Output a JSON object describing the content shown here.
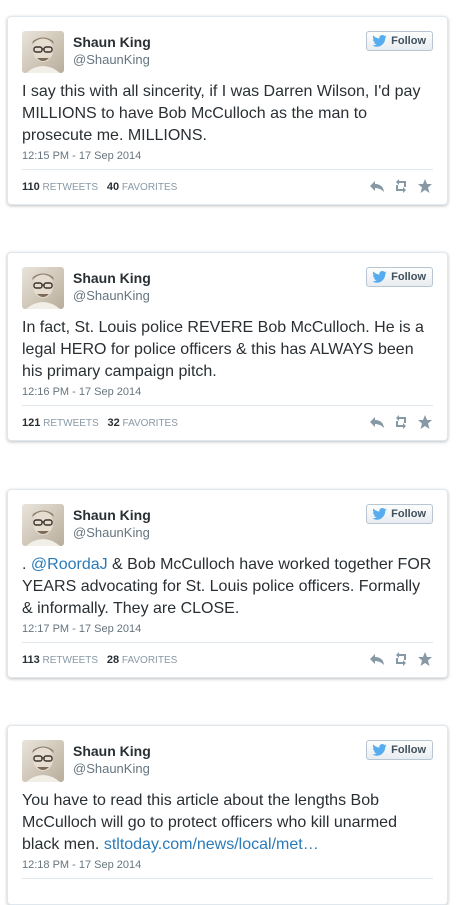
{
  "colors": {
    "link": "#2b7bb9",
    "twitter_blue": "#55acee",
    "text": "#292f33",
    "muted": "#66757f",
    "icon": "#8899a6"
  },
  "icons": {
    "follow": "twitter-bird-icon",
    "reply": "reply-icon",
    "retweet": "retweet-icon",
    "favorite": "star-icon"
  },
  "tweets": [
    {
      "author": {
        "name": "Shaun King",
        "handle": "@ShaunKing"
      },
      "follow_label": "Follow",
      "text": "I say this with all sincerity, if I was Darren Wilson, I'd pay MILLIONS to have Bob McCulloch as the man to prosecute me. MILLIONS.",
      "timestamp": "12:15 PM - 17 Sep 2014",
      "retweets": "110",
      "retweets_label": "RETWEETS",
      "favorites": "40",
      "favorites_label": "FAVORITES"
    },
    {
      "author": {
        "name": "Shaun King",
        "handle": "@ShaunKing"
      },
      "follow_label": "Follow",
      "text": "In fact, St. Louis police REVERE Bob McCulloch. He is a legal HERO for police officers & this has ALWAYS been his primary campaign pitch.",
      "timestamp": "12:16 PM - 17 Sep 2014",
      "retweets": "121",
      "retweets_label": "RETWEETS",
      "favorites": "32",
      "favorites_label": "FAVORITES"
    },
    {
      "author": {
        "name": "Shaun King",
        "handle": "@ShaunKing"
      },
      "follow_label": "Follow",
      "text_prefix": ". ",
      "mention": "@RoordaJ",
      "text": " & Bob McCulloch have worked together FOR YEARS advocating for St. Louis police officers. Formally & informally. They are CLOSE.",
      "timestamp": "12:17 PM - 17 Sep 2014",
      "retweets": "113",
      "retweets_label": "RETWEETS",
      "favorites": "28",
      "favorites_label": "FAVORITES"
    },
    {
      "author": {
        "name": "Shaun King",
        "handle": "@ShaunKing"
      },
      "follow_label": "Follow",
      "text": "You have to read this article about the lengths Bob McCulloch will go to protect officers who kill unarmed black men. ",
      "link": "stltoday.com/news/local/met…",
      "timestamp": "12:18 PM - 17 Sep 2014"
    }
  ]
}
